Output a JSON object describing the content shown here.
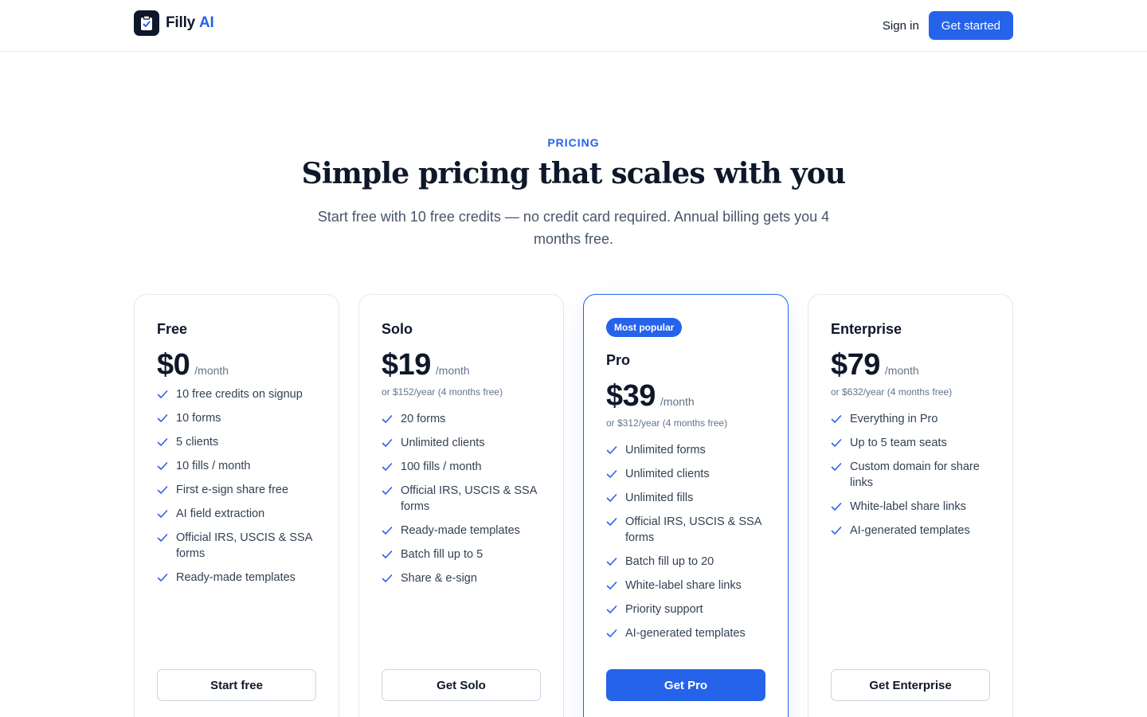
{
  "header": {
    "brand": "Filly",
    "brand_accent": "AI",
    "logo_icon": "clipboard-check-icon",
    "signin_label": "Sign in",
    "get_started_label": "Get started"
  },
  "hero": {
    "eyebrow": "PRICING",
    "headline": "Simple pricing that scales with you",
    "subtitle": "Start free with 10 free credits — no credit card required. Annual billing gets you 4 months free."
  },
  "colors": {
    "accent": "#2563eb",
    "ink": "#0f172a",
    "muted": "#64748b",
    "border": "#e5e7eb"
  },
  "plans": [
    {
      "name": "Free",
      "price": "$0",
      "per": "/month",
      "annual": "",
      "badge": "",
      "features": [
        "10 free credits on signup",
        "10 forms",
        "5 clients",
        "10 fills / month",
        "First e-sign share free",
        "AI field extraction",
        "Official IRS, USCIS & SSA forms",
        "Ready-made templates"
      ],
      "cta": "Start free"
    },
    {
      "name": "Solo",
      "price": "$19",
      "per": "/month",
      "annual": "or $152/year (4 months free)",
      "badge": "",
      "features": [
        "20 forms",
        "Unlimited clients",
        "100 fills / month",
        "Official IRS, USCIS & SSA forms",
        "Ready-made templates",
        "Batch fill up to 5",
        "Share & e-sign"
      ],
      "cta": "Get Solo"
    },
    {
      "name": "Pro",
      "price": "$39",
      "per": "/month",
      "annual": "or $312/year (4 months free)",
      "badge": "Most popular",
      "features": [
        "Unlimited forms",
        "Unlimited clients",
        "Unlimited fills",
        "Official IRS, USCIS & SSA forms",
        "Batch fill up to 20",
        "White-label share links",
        "Priority support",
        "AI-generated templates"
      ],
      "cta": "Get Pro"
    },
    {
      "name": "Enterprise",
      "price": "$79",
      "per": "/month",
      "annual": "or $632/year (4 months free)",
      "badge": "",
      "features": [
        "Everything in Pro",
        "Up to 5 team seats",
        "Custom domain for share links",
        "White-label share links",
        "AI-generated templates"
      ],
      "cta": "Get Enterprise"
    }
  ]
}
